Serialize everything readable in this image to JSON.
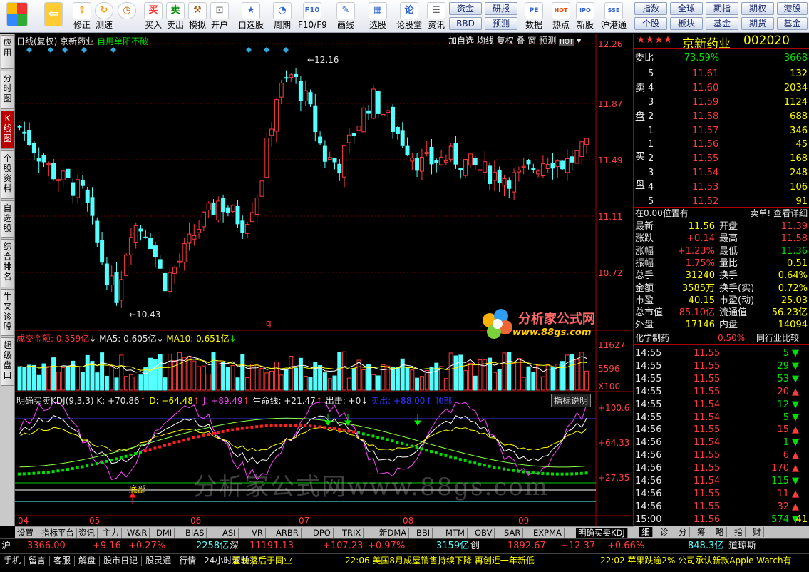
{
  "toolbar": {
    "items": [
      {
        "label": "",
        "icon": "back-arrow-icon"
      },
      {
        "label": "修正",
        "icon": "up-down-arrows-icon"
      },
      {
        "label": "测速",
        "icon": "refresh-icon"
      },
      {
        "label": "",
        "icon": "clock-icon"
      },
      {
        "label": "买入",
        "icon": "buy-icon"
      },
      {
        "label": "卖出",
        "icon": "sell-icon"
      },
      {
        "label": "模拟",
        "icon": "hammer-icon"
      },
      {
        "label": "开户",
        "icon": "lock-icon"
      },
      {
        "label": "自选股",
        "icon": "star-icon"
      },
      {
        "label": "周期",
        "icon": "period-icon"
      },
      {
        "label": "F10/F9",
        "icon": "f10-icon"
      },
      {
        "label": "画线",
        "icon": "pen-icon"
      },
      {
        "label": "选股",
        "icon": "select-stock-icon"
      },
      {
        "label": "论股堂",
        "icon": "forum-icon"
      },
      {
        "label": "资讯",
        "icon": "news-icon"
      },
      {
        "label": "数据",
        "icon": "pe-icon"
      },
      {
        "label": "热点",
        "icon": "hot-icon"
      },
      {
        "label": "新股",
        "icon": "ipo-icon"
      },
      {
        "label": "沪港通",
        "icon": "hk-connect-icon"
      }
    ],
    "glyphs": {
      "buy": "买",
      "sell": "卖",
      "f10": "F10",
      "forum": "论",
      "pe": "PE",
      "hot": "HOT",
      "ipo": "IPO",
      "hk": "SSE"
    },
    "small_buttons": [
      "资金",
      "研报",
      "BBD",
      "预测",
      "指数",
      "全球",
      "期指",
      "期权",
      "港股",
      "个股",
      "板块",
      "基金",
      "期货",
      "基金"
    ]
  },
  "left_tabs": [
    "应用",
    "分时图",
    "K线图",
    "个股资料",
    "自选股",
    "综合排名",
    "牛叉诊股",
    "超级盘口"
  ],
  "chart": {
    "header_left": "日线(复权)  京新药业",
    "header_formula": "自用单阳不破",
    "header_buttons": [
      "加自选",
      "均线",
      "复权",
      "叠",
      "窗",
      "预测"
    ],
    "price_ticks": [
      "12.26",
      "11.87",
      "11.49",
      "11.11",
      "10.72"
    ],
    "high_label": "12.16",
    "low_label": "10.43",
    "q_mark": "q",
    "volume_header": {
      "label": "成交金额:",
      "value": "0.359亿",
      "ma5_label": "MA5:",
      "ma5": "0.605亿",
      "ma10_label": "MA10:",
      "ma10": "0.651亿"
    },
    "volume_ticks": [
      "11627",
      "5596",
      "X100"
    ],
    "kdj_header": {
      "name": "明确买卖KDJ(9,3,3)",
      "k": "K: +70.86",
      "d": "D: +64.48",
      "j": "J: +89.49",
      "life": "生命线: +21.47",
      "out": "出击: +0",
      "sell": "卖出: +88.00",
      "top": "顶部"
    },
    "kdj_help": "指标说明",
    "kdj_ticks": [
      "+100.6",
      "+64.33",
      "+27.35"
    ],
    "bottom_label": "底部",
    "dates": [
      "04",
      "05",
      "06",
      "07",
      "08",
      "09"
    ],
    "watermark": "分析家公式网www.88gs.com",
    "logo_text": "分析家公式网",
    "logo_url": "www.88gs.com"
  },
  "chart_data": {
    "type": "candlestick",
    "ylim": [
      10.43,
      12.26
    ],
    "high": 12.16,
    "low": 10.43,
    "volume": {
      "value": "0.359亿",
      "ma5": "0.605亿",
      "ma10": "0.651亿"
    },
    "kdj": {
      "k": 70.86,
      "d": 64.48,
      "j": 89.49,
      "life": 21.47
    }
  },
  "stock": {
    "name": "京新药业",
    "code": "002020",
    "stars": "★★★★",
    "weibi_label": "委比",
    "weibi": "-73.59%",
    "weicha": "-3668",
    "sell_label": [
      "卖",
      "盘"
    ],
    "buy_label": [
      "买",
      "盘"
    ],
    "asks": [
      [
        "5",
        "11.61",
        "132"
      ],
      [
        "4",
        "11.60",
        "2034"
      ],
      [
        "3",
        "11.59",
        "1124"
      ],
      [
        "2",
        "11.58",
        "688"
      ],
      [
        "1",
        "11.57",
        "346"
      ]
    ],
    "bids": [
      [
        "1",
        "11.56",
        "45"
      ],
      [
        "2",
        "11.55",
        "168"
      ],
      [
        "3",
        "11.54",
        "248"
      ],
      [
        "4",
        "11.53",
        "106"
      ],
      [
        "5",
        "11.52",
        "91"
      ]
    ],
    "pos_text": "在0.00位置有",
    "sell_note": "卖单! 查看详细",
    "stats": [
      [
        "最新",
        "11.56",
        "开盘",
        "11.39"
      ],
      [
        "涨跌",
        "+0.14",
        "最高",
        "11.58"
      ],
      [
        "涨幅",
        "+1.23%",
        "最低",
        "11.36"
      ],
      [
        "振幅",
        "1.75%",
        "量比",
        "0.51"
      ],
      [
        "总手",
        "31240",
        "换手",
        "0.64%"
      ],
      [
        "金额",
        "3585万",
        "换手(实)",
        "0.72%"
      ],
      [
        "市盈",
        "40.15",
        "市盈(动)",
        "25.03"
      ],
      [
        "总市值",
        "85.10亿",
        "流通值",
        "56.23亿"
      ],
      [
        "外盘",
        "17146",
        "内盘",
        "14094"
      ]
    ],
    "industry": "化学制药",
    "industry_pct": "0.50%",
    "industry_cmp": "同行业比较",
    "ticks": [
      [
        "14:55",
        "11.55",
        "5",
        "down"
      ],
      [
        "14:55",
        "11.55",
        "29",
        "down"
      ],
      [
        "14:55",
        "11.55",
        "53",
        "down"
      ],
      [
        "14:55",
        "11.55",
        "20",
        "up"
      ],
      [
        "14:55",
        "11.54",
        "12",
        "down"
      ],
      [
        "14:55",
        "11.54",
        "5",
        "down"
      ],
      [
        "14:56",
        "11.55",
        "15",
        "up"
      ],
      [
        "14:56",
        "11.54",
        "1",
        "down"
      ],
      [
        "14:56",
        "11.55",
        "6",
        "up"
      ],
      [
        "14:56",
        "11.55",
        "170",
        "up"
      ],
      [
        "14:56",
        "11.54",
        "115",
        "down"
      ],
      [
        "14:56",
        "11.55",
        "11",
        "up"
      ],
      [
        "14:56",
        "11.55",
        "32",
        "up"
      ],
      [
        "15:00",
        "11.56",
        "574",
        "down"
      ]
    ],
    "tick_extra": "41"
  },
  "subtabs": [
    "设置",
    "指标平台",
    "资讯",
    "主力",
    "W&R",
    "DMI",
    "BIAS",
    "ASI",
    "VR",
    "ARBR",
    "DPO",
    "TRIX",
    "新DMA",
    "BBI",
    "MTM",
    "OBV",
    "SAR",
    "EXPMA",
    "明确买卖KDJ"
  ],
  "right_tabs": [
    "细",
    "诊",
    "分",
    "筹",
    "略",
    "指",
    "财"
  ],
  "index": {
    "sh_label": "沪",
    "sh": "3366.00",
    "sh_chg": "+9.16",
    "sh_pct": "+0.27%",
    "sh_amt": "2258亿",
    "sz_label": "深",
    "sz": "11191.13",
    "sz_chg": "+107.23",
    "sz_pct": "+0.97%",
    "sz_amt": "3159亿",
    "cy_label": "创",
    "cy": "1892.67",
    "cy_chg": "+12.37",
    "cy_pct": "+0.66%",
    "dj_amt": "848.3亿",
    "dj_label": "道琼斯"
  },
  "status": {
    "items": [
      "手机",
      "留言",
      "客服",
      "解盘",
      "股市日记",
      "股灵通",
      "行情",
      "24小时滚动"
    ],
    "news1": "暂长落后于同业",
    "news2": "22:06 美国8月成屋销售持续下降 再创近一年新低",
    "news3": "22:02 苹果跌逾2% 公司承认新款Apple Watch有"
  },
  "colors": {
    "up": "#ff3b3b",
    "down": "#54ffff",
    "k": "#ffffff",
    "d": "#ffff00",
    "j": "#ff44ff",
    "life": "#00e000"
  }
}
